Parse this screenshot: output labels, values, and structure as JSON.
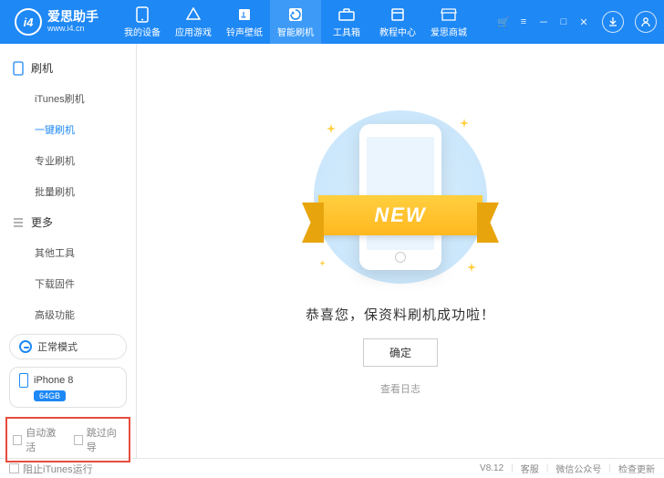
{
  "header": {
    "brand": "爱思助手",
    "url": "www.i4.cn",
    "nav": [
      {
        "label": "我的设备",
        "icon": "phone"
      },
      {
        "label": "应用游戏",
        "icon": "apps"
      },
      {
        "label": "铃声壁纸",
        "icon": "music"
      },
      {
        "label": "智能刷机",
        "icon": "flash",
        "active": true
      },
      {
        "label": "工具箱",
        "icon": "toolbox"
      },
      {
        "label": "教程中心",
        "icon": "book"
      },
      {
        "label": "爱思商城",
        "icon": "store"
      }
    ]
  },
  "sidebar": {
    "groups": [
      {
        "title": "刷机",
        "icon": "phone",
        "items": [
          "iTunes刷机",
          "一键刷机",
          "专业刷机",
          "批量刷机"
        ],
        "active_index": 1
      },
      {
        "title": "更多",
        "icon": "menu",
        "items": [
          "其他工具",
          "下载固件",
          "高级功能"
        ]
      }
    ],
    "mode": "正常模式",
    "device": {
      "name": "iPhone 8",
      "storage": "64GB"
    },
    "red_options": [
      "自动激活",
      "跳过向导"
    ]
  },
  "main": {
    "ribbon": "NEW",
    "message": "恭喜您，保资料刷机成功啦！",
    "ok": "确定",
    "view_log": "查看日志"
  },
  "footer": {
    "block_itunes": "阻止iTunes运行",
    "version": "V8.12",
    "links": [
      "客服",
      "微信公众号",
      "检查更新"
    ]
  }
}
